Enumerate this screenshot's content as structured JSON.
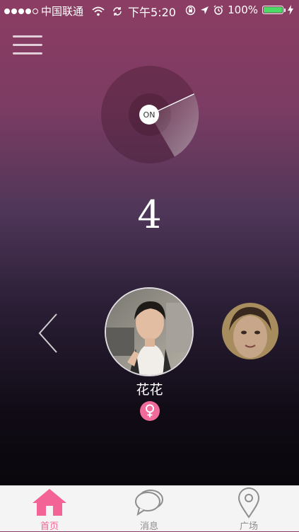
{
  "status_bar": {
    "carrier": "中国联通",
    "time": "下午5:20",
    "battery_percent": "100%",
    "battery_level": 1.0,
    "signal_bars": 4,
    "battery_color": "#4cd964"
  },
  "radar": {
    "toggle_label": "ON"
  },
  "nearby_count": "4",
  "profile": {
    "name": "花花",
    "gender": "female",
    "gender_color": "#f06a9a"
  },
  "tabbar": {
    "tabs": [
      {
        "label": "首页",
        "icon": "home-icon",
        "active": true
      },
      {
        "label": "消息",
        "icon": "chat-icon",
        "active": false
      },
      {
        "label": "广场",
        "icon": "location-pin-icon",
        "active": false
      }
    ],
    "active_color": "#f46396",
    "inactive_color": "#8e8e8e"
  }
}
